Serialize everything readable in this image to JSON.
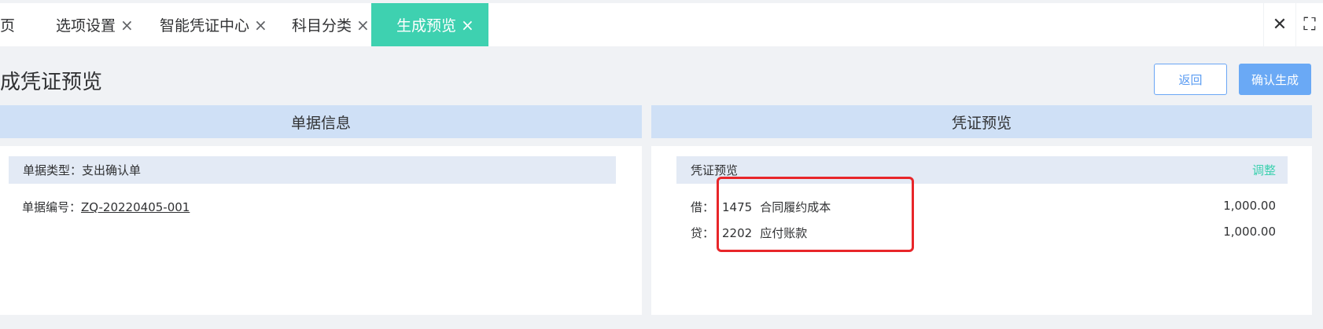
{
  "tabs": [
    {
      "label": "页",
      "close": ""
    },
    {
      "label": "选项设置",
      "close": "×"
    },
    {
      "label": "智能凭证中心",
      "close": "×"
    },
    {
      "label": "科目分类",
      "close": "×"
    },
    {
      "label": "生成预览",
      "close": "×"
    }
  ],
  "tabbar": {
    "close_all": "✕",
    "fullscreen": "⛶"
  },
  "page": {
    "title": "成凭证预览"
  },
  "buttons": {
    "back": "返回",
    "confirm": "确认生成"
  },
  "left_panel": {
    "header": "单据信息",
    "type_label": "单据类型：",
    "type_value": "支出确认单",
    "no_label": "单据编号：",
    "no_value": "ZQ-20220405-001"
  },
  "right_panel": {
    "header": "凭证预览",
    "bar_title": "凭证预览",
    "adjust": "调整",
    "entries": [
      {
        "direction": "借：",
        "code": "1475",
        "name": "合同履约成本",
        "amount": "1,000.00"
      },
      {
        "direction": "贷：",
        "code": "2202",
        "name": "应付账款",
        "amount": "1,000.00"
      }
    ]
  },
  "colors": {
    "active_tab": "#3ed1b0",
    "panel_header": "#cfe0f6",
    "primary": "#6aa9f5",
    "highlight": "#e8262a"
  }
}
